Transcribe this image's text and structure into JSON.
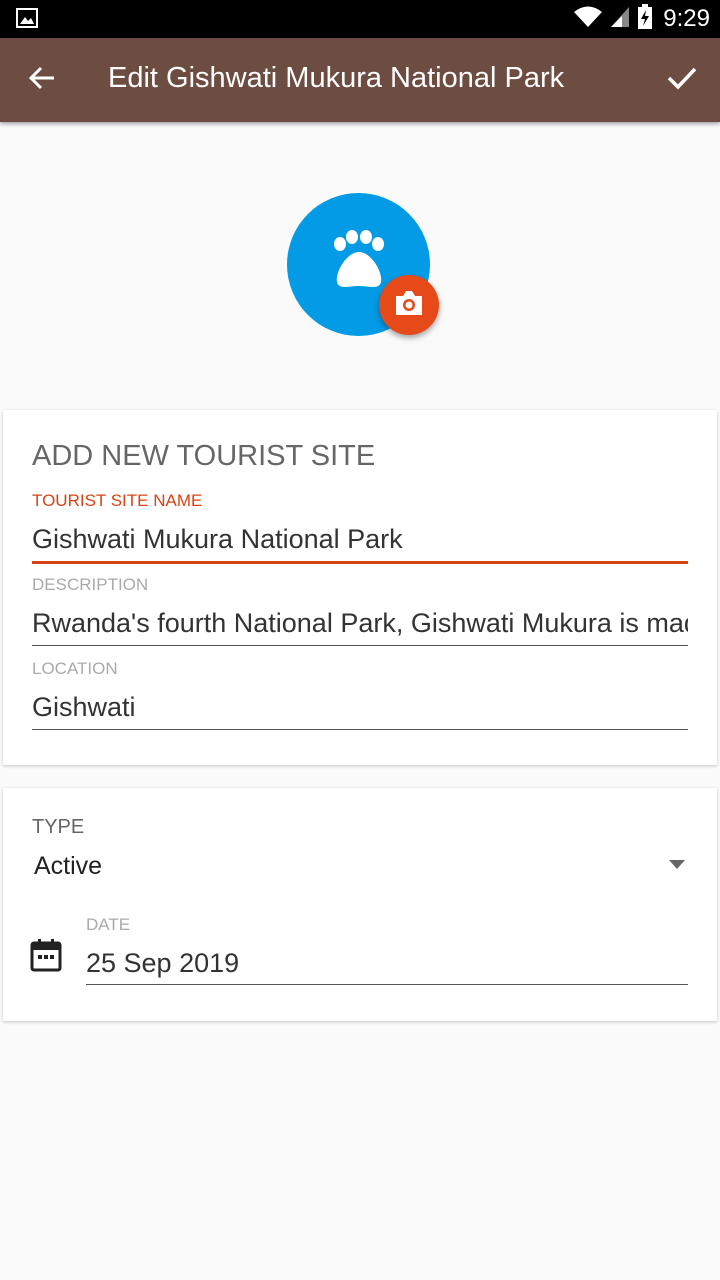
{
  "status_bar": {
    "time": "9:29",
    "icons": [
      "image-icon",
      "wifi-icon",
      "signal-icon",
      "battery-charging-icon"
    ]
  },
  "app_bar": {
    "title": "Edit Gishwati Mukura National Park",
    "back_icon": "arrow-back-icon",
    "save_icon": "check-icon",
    "color": "#6d4c41"
  },
  "avatar": {
    "icon": "paw-icon",
    "color": "#039be5",
    "camera_icon": "camera-icon",
    "camera_color": "#e64a19"
  },
  "form": {
    "heading": "ADD NEW TOURIST SITE",
    "name_label": "TOURIST SITE NAME",
    "name_value": "Gishwati Mukura National Park",
    "description_label": "DESCRIPTION",
    "description_value": "Rwanda's fourth National Park, Gishwati Mukura is made",
    "location_label": "LOCATION",
    "location_value": "Gishwati",
    "accent_color": "#d84315"
  },
  "details": {
    "type_label": "TYPE",
    "type_value": "Active",
    "date_label": "DATE",
    "date_value": "25 Sep 2019",
    "date_icon": "calendar-icon"
  }
}
